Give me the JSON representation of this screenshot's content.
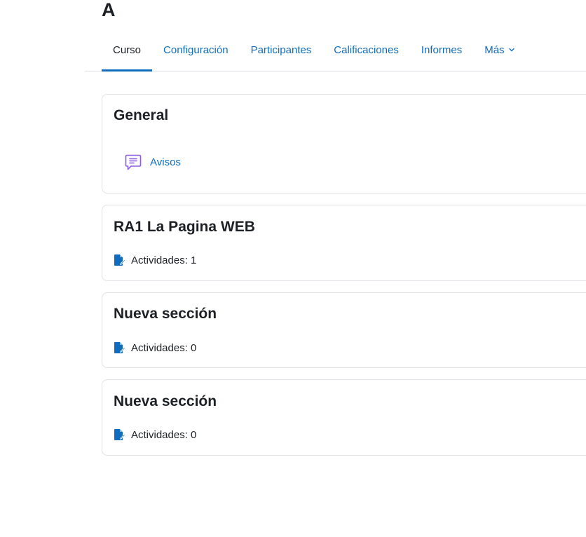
{
  "page": {
    "title": "A"
  },
  "nav": {
    "tabs": [
      {
        "label": "Curso",
        "active": true
      },
      {
        "label": "Configuración",
        "active": false
      },
      {
        "label": "Participantes",
        "active": false
      },
      {
        "label": "Calificaciones",
        "active": false
      },
      {
        "label": "Informes",
        "active": false
      },
      {
        "label": "Más",
        "active": false,
        "icon": "chevron-down-icon"
      }
    ]
  },
  "sections": [
    {
      "title": "General",
      "activities": [
        {
          "label": "Avisos",
          "icon": "forum-icon"
        }
      ]
    },
    {
      "title": "RA1 La Pagina WEB",
      "summary": "Actividades: 1",
      "summary_icon": "activities-icon"
    },
    {
      "title": "Nueva sección",
      "summary": "Actividades: 0",
      "summary_icon": "activities-icon"
    },
    {
      "title": "Nueva sección",
      "summary": "Actividades: 0",
      "summary_icon": "activities-icon"
    }
  ],
  "colors": {
    "link": "#0f6cbf",
    "text": "#1d2125",
    "border": "#dee2e6",
    "forum_icon": "#8c5de0",
    "activities_icon": "#0f6cbf"
  }
}
